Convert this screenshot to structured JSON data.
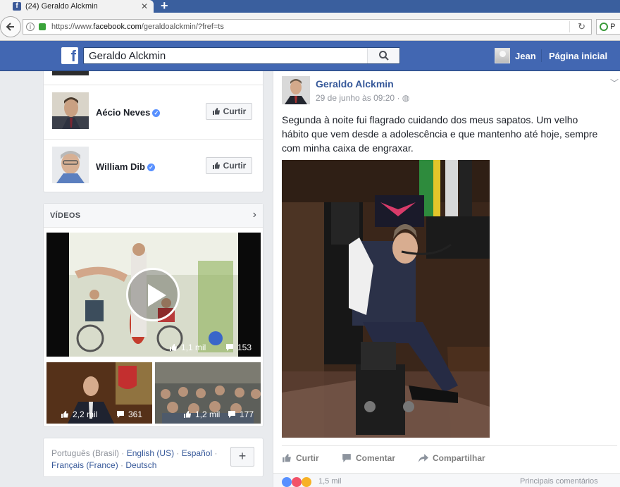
{
  "browser": {
    "tab_title": "(24) Geraldo Alckmin",
    "url_prefix": "https://www.",
    "url_domain": "facebook.com",
    "url_suffix": "/geraldoalckmin/?fref=ts",
    "search_ext_label": "P"
  },
  "header": {
    "logo": "f",
    "search_value": "Geraldo Alckmin",
    "user_name": "Jean",
    "home_label": "Página inicial"
  },
  "people": [
    {
      "name": "Aécio Neves",
      "like_label": "Curtir"
    },
    {
      "name": "William Dib",
      "like_label": "Curtir"
    }
  ],
  "videos": {
    "title": "VÍDEOS",
    "items": [
      {
        "likes": "1,1 mil",
        "comments": "153"
      },
      {
        "likes": "2,2 mil",
        "comments": "361"
      },
      {
        "likes": "1,2 mil",
        "comments": "177"
      }
    ]
  },
  "footer": {
    "lang_current": "Português (Brasil)",
    "lang_1": "English (US)",
    "lang_2": "Español",
    "lang_3": "Français (France)",
    "lang_4": "Deutsch",
    "plus": "+"
  },
  "post": {
    "author": "Geraldo Alckmin",
    "date": "29 de junho às 09:20",
    "privacy_glyph": "·",
    "text": "Segunda à noite fui flagrado cuidando dos meus sapatos. Um velho hábito que vem desde a adolescência e que mantenho até hoje, sempre com minha caixa de engraxar.",
    "actions": {
      "like": "Curtir",
      "comment": "Comentar",
      "share": "Compartilhar"
    },
    "reaction_count": "1,5 mil",
    "reaction_tail": "Principais comentários"
  },
  "colors": {
    "facebook_blue": "#4267b2",
    "link_blue": "#365899",
    "browser_tab_bg": "#3a5f9e"
  }
}
